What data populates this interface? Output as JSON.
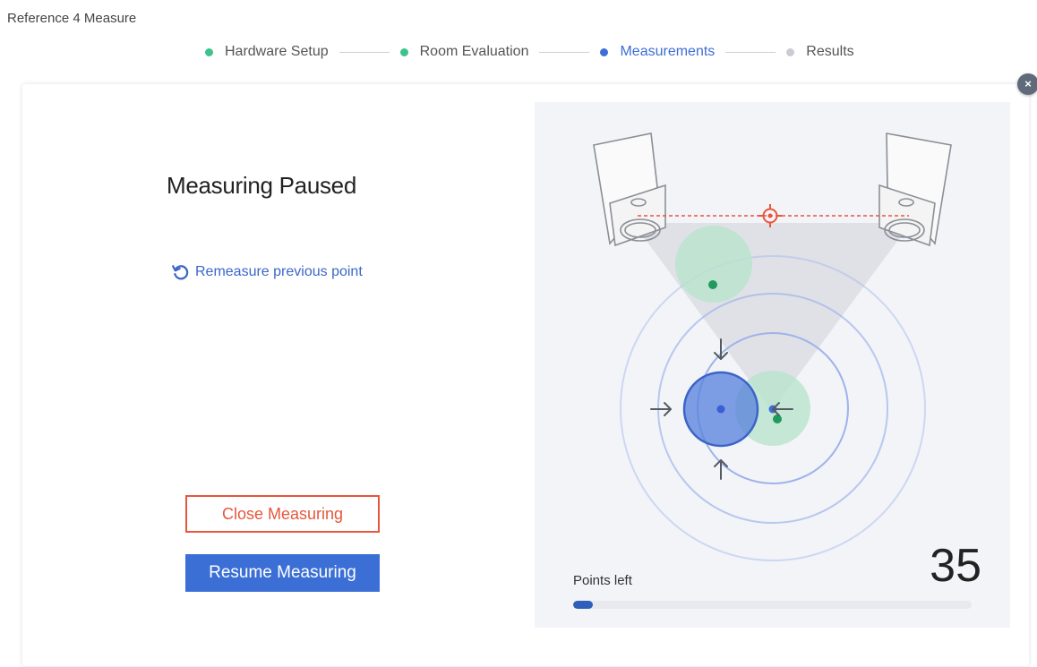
{
  "app": {
    "title": "Reference 4 Measure"
  },
  "stepper": {
    "steps": [
      {
        "label": "Hardware Setup",
        "color": "#3dc28e",
        "state": "done"
      },
      {
        "label": "Room Evaluation",
        "color": "#3dc28e",
        "state": "done"
      },
      {
        "label": "Measurements",
        "color": "#3d6ed8",
        "state": "active"
      },
      {
        "label": "Results",
        "color": "#c9ccd3",
        "state": "pending"
      }
    ]
  },
  "dialog": {
    "close_icon": "×",
    "title": "Measuring Paused",
    "remeasure_label": "Remeasure previous point",
    "close_button": "Close Measuring",
    "resume_button": "Resume Measuring"
  },
  "visualization": {
    "points_left_label": "Points left",
    "points_left_value": "35",
    "progress_fraction": 0.05,
    "colors": {
      "accent": "#3d6ed8",
      "measured": "#1f9a5c",
      "target": "#e8563c"
    }
  }
}
